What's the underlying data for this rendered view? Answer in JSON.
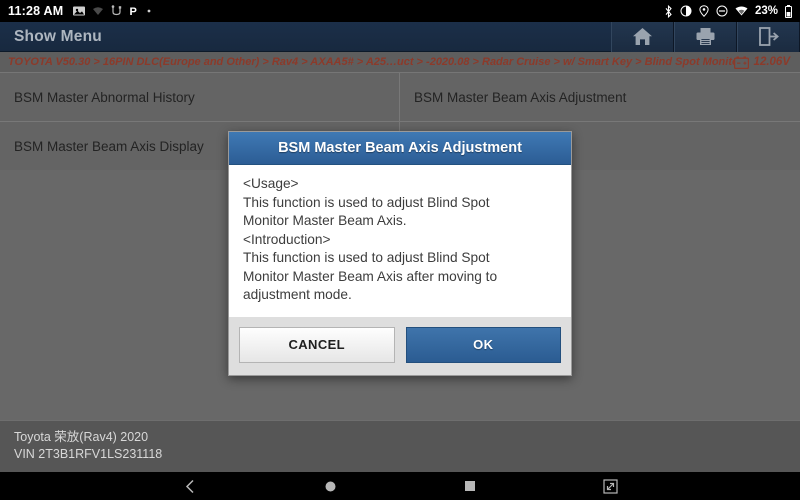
{
  "status_bar": {
    "time": "11:28 AM",
    "left_icons": [
      "screenshot-icon",
      "weak-signal-icon",
      "usb-icon",
      "parking-p-icon",
      "dot-icon"
    ],
    "right_icons": [
      "bluetooth-icon",
      "brightness-icon",
      "location-icon",
      "do-not-disturb-icon",
      "wifi-icon"
    ],
    "battery_percent": "23%",
    "battery_icon": "battery-icon"
  },
  "appbar": {
    "title": "Show Menu",
    "tools": [
      {
        "name": "home-button",
        "icon": "home-icon"
      },
      {
        "name": "print-button",
        "icon": "printer-icon"
      },
      {
        "name": "exit-button",
        "icon": "exit-icon"
      }
    ]
  },
  "breadcrumb": {
    "path": "TOYOTA V50.30 > 16PIN DLC(Europe and Other) > Rav4 > AXAA5# > A25…uct > -2020.08 > Radar Cruise > w/ Smart Key > Blind Spot Monitor Master",
    "battery_icon": "car-battery-icon",
    "voltage": "12.06V"
  },
  "menu": {
    "rows": [
      [
        "BSM Master Abnormal History",
        "BSM Master Beam Axis Adjustment"
      ],
      [
        "BSM Master Beam Axis Display",
        ""
      ]
    ]
  },
  "dialog": {
    "title": "BSM Master Beam Axis Adjustment",
    "body": "<Usage>\nThis function is used to adjust Blind Spot\nMonitor Master Beam Axis.\n<Introduction>\nThis function is used to adjust Blind Spot\nMonitor Master Beam Axis after moving to\nadjustment mode.",
    "cancel_label": "CANCEL",
    "ok_label": "OK"
  },
  "footer": {
    "vehicle": "Toyota 荣放(Rav4) 2020",
    "vin": "VIN 2T3B1RFV1LS231118"
  },
  "navbar": {
    "buttons": [
      {
        "name": "nav-back-button",
        "icon": "chevron-left-icon"
      },
      {
        "name": "nav-home-button",
        "icon": "circle-icon"
      },
      {
        "name": "nav-recents-button",
        "icon": "square-icon"
      },
      {
        "name": "nav-screenshot-button",
        "icon": "screenshot-icon"
      }
    ]
  },
  "colors": {
    "appbar": "#1b2f49",
    "accent": "#2c5d95",
    "breadcrumb_text": "#8c3a2a",
    "background": "#666666"
  }
}
